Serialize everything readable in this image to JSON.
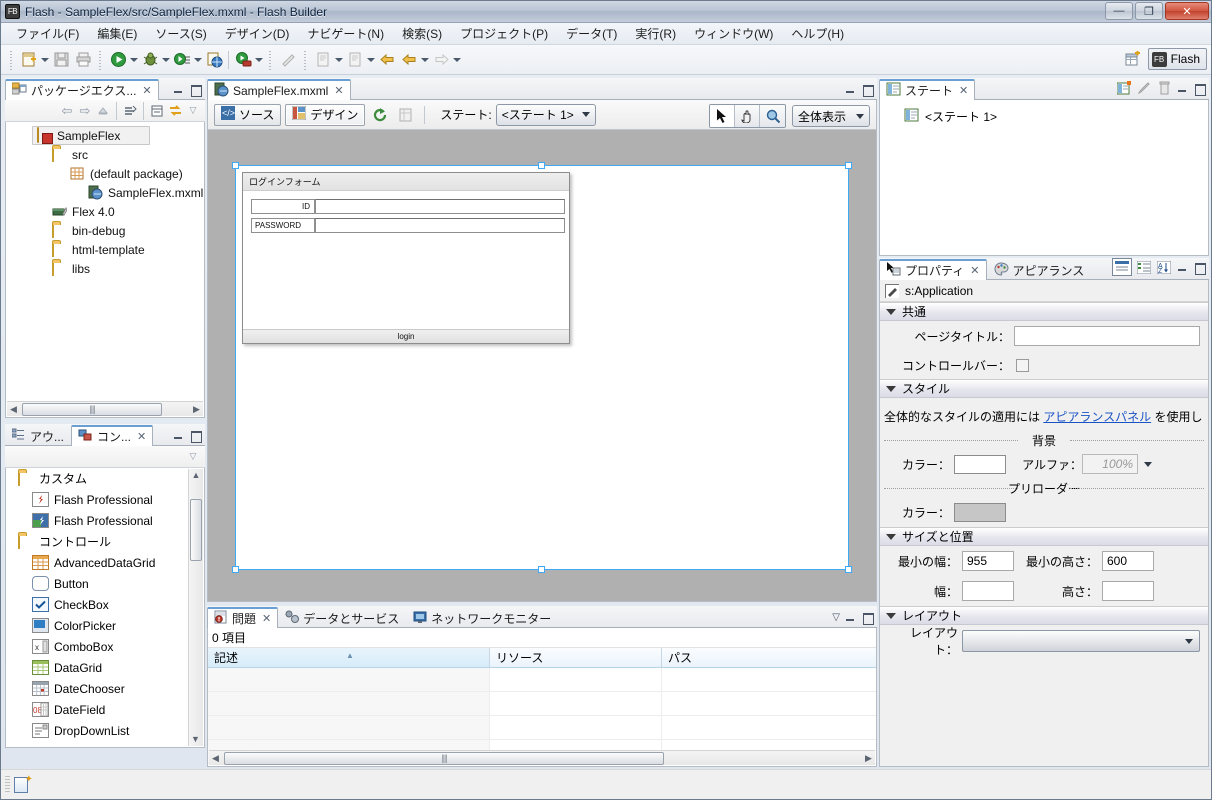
{
  "window": {
    "title": "Flash - SampleFlex/src/SampleFlex.mxml - Flash Builder",
    "app_icon": "FB",
    "minimize": "—",
    "restore": "❐",
    "close": "✕"
  },
  "menu": [
    {
      "label": "ファイル(F)"
    },
    {
      "label": "編集(E)"
    },
    {
      "label": "ソース(S)"
    },
    {
      "label": "デザイン(D)"
    },
    {
      "label": "ナビゲート(N)"
    },
    {
      "label": "検索(S)"
    },
    {
      "label": "プロジェクト(P)"
    },
    {
      "label": "データ(T)"
    },
    {
      "label": "実行(R)"
    },
    {
      "label": "ウィンドウ(W)"
    },
    {
      "label": "ヘルプ(H)"
    }
  ],
  "toolbar": {
    "perspective_button": "Flash",
    "perspective_icon": "FB",
    "open_perspective_icon": "open-perspective-icon"
  },
  "package_explorer": {
    "tab_label": "パッケージエクス...",
    "tree": [
      {
        "label": "SampleFlex",
        "icon": "flex-project-icon",
        "indent": 0,
        "selected": true
      },
      {
        "label": "src",
        "icon": "source-folder-icon",
        "indent": 1,
        "selected": false
      },
      {
        "label": "(default package)",
        "icon": "package-icon",
        "indent": 2,
        "selected": false
      },
      {
        "label": "SampleFlex.mxml",
        "icon": "mxml-file-icon",
        "indent": 3,
        "selected": false
      },
      {
        "label": "Flex 4.0",
        "icon": "library-icon",
        "indent": 1,
        "selected": false
      },
      {
        "label": "bin-debug",
        "icon": "folder-icon",
        "indent": 1,
        "selected": false
      },
      {
        "label": "html-template",
        "icon": "folder-icon",
        "indent": 1,
        "selected": false
      },
      {
        "label": "libs",
        "icon": "folder-icon",
        "indent": 1,
        "selected": false
      }
    ]
  },
  "components_view": {
    "tabs": [
      {
        "label": "アウ...",
        "active": false,
        "icon": "outline-icon"
      },
      {
        "label": "コン...",
        "active": true,
        "icon": "components-icon"
      }
    ],
    "items": [
      {
        "label": "カスタム",
        "type": "group",
        "icon": "folder-icon"
      },
      {
        "label": "Flash Professional",
        "type": "item",
        "icon": "flash-pro-icon"
      },
      {
        "label": "Flash Professional",
        "type": "item",
        "icon": "flash-pro-comp-icon"
      },
      {
        "label": "コントロール",
        "type": "group",
        "icon": "folder-icon"
      },
      {
        "label": "AdvancedDataGrid",
        "type": "item",
        "icon": "advanced-datagrid-icon"
      },
      {
        "label": "Button",
        "type": "item",
        "icon": "button-icon"
      },
      {
        "label": "CheckBox",
        "type": "item",
        "icon": "checkbox-icon"
      },
      {
        "label": "ColorPicker",
        "type": "item",
        "icon": "colorpicker-icon"
      },
      {
        "label": "ComboBox",
        "type": "item",
        "icon": "combobox-icon"
      },
      {
        "label": "DataGrid",
        "type": "item",
        "icon": "datagrid-icon"
      },
      {
        "label": "DateChooser",
        "type": "item",
        "icon": "datechooser-icon"
      },
      {
        "label": "DateField",
        "type": "item",
        "icon": "datefield-icon"
      },
      {
        "label": "DropDownList",
        "type": "item",
        "icon": "dropdownlist-icon"
      }
    ]
  },
  "editor": {
    "tab_label": "SampleFlex.mxml",
    "tab_icon": "mxml-file-icon",
    "source_button": "ソース",
    "design_button": "デザイン",
    "state_label": "ステート:",
    "state_value": "<ステート 1>",
    "zoom_value": "全体表示",
    "tools": [
      {
        "name": "select-tool",
        "glyph": "➤",
        "active": true
      },
      {
        "name": "hand-tool",
        "glyph": "✋",
        "active": false
      },
      {
        "name": "zoom-tool",
        "glyph": "🔍",
        "active": false
      }
    ],
    "design": {
      "panel_title": "ログインフォーム",
      "fields": [
        {
          "label": "ID",
          "value": "",
          "align": "right"
        },
        {
          "label": "PASSWORD",
          "value": "",
          "align": "left"
        }
      ],
      "footer_button": "login"
    }
  },
  "problems": {
    "tabs": [
      {
        "label": "問題",
        "active": true,
        "icon": "problems-icon"
      },
      {
        "label": "データとサービス",
        "active": false,
        "icon": "data-services-icon"
      },
      {
        "label": "ネットワークモニター",
        "active": false,
        "icon": "network-monitor-icon"
      }
    ],
    "count_text": "0 項目",
    "columns": [
      "記述",
      "リソース",
      "パス"
    ],
    "rows": []
  },
  "states": {
    "tab_label": "ステート",
    "items": [
      {
        "label": "<ステート 1>",
        "icon": "state-icon"
      }
    ],
    "tools": [
      {
        "name": "new-state-icon"
      },
      {
        "name": "edit-state-icon"
      },
      {
        "name": "delete-state-icon"
      }
    ]
  },
  "properties": {
    "tabs": [
      {
        "label": "プロパティ",
        "active": true,
        "icon": "properties-icon"
      },
      {
        "label": "アピアランス",
        "active": false,
        "icon": "appearance-icon"
      }
    ],
    "object_name": "s:Application",
    "sections": {
      "common": {
        "title": "共通",
        "page_title_label": "ページタイトル：",
        "page_title_value": "",
        "control_bar_label": "コントロールバー：",
        "control_bar_checked": false
      },
      "style": {
        "title": "スタイル",
        "note_prefix": "全体的なスタイルの適用には ",
        "note_link": "アピアランスパネル",
        "note_suffix": " を使用し",
        "background_header": "背景",
        "color_label": "カラー：",
        "color_value": "#FFFFFF",
        "alpha_label": "アルファ：",
        "alpha_value": "100%",
        "preloader_header": "プリローダー",
        "preloader_color_label": "カラー：",
        "preloader_color_value": "#C6C6C6"
      },
      "size": {
        "title": "サイズと位置",
        "min_width_label": "最小の幅：",
        "min_width_value": "955",
        "min_height_label": "最小の高さ：",
        "min_height_value": "600",
        "width_label": "幅：",
        "width_value": "",
        "height_label": "高さ：",
        "height_value": ""
      },
      "layout": {
        "title": "レイアウト",
        "layout_label": "レイアウト：",
        "layout_value": ""
      }
    }
  },
  "status_bar": {
    "icon": "writable-icon"
  },
  "colors": {
    "accent": "#3fa9f5",
    "link": "#1a53c4",
    "canvas_bg": "#b0b0b0",
    "tab_active_top": "#6a9fd4"
  }
}
